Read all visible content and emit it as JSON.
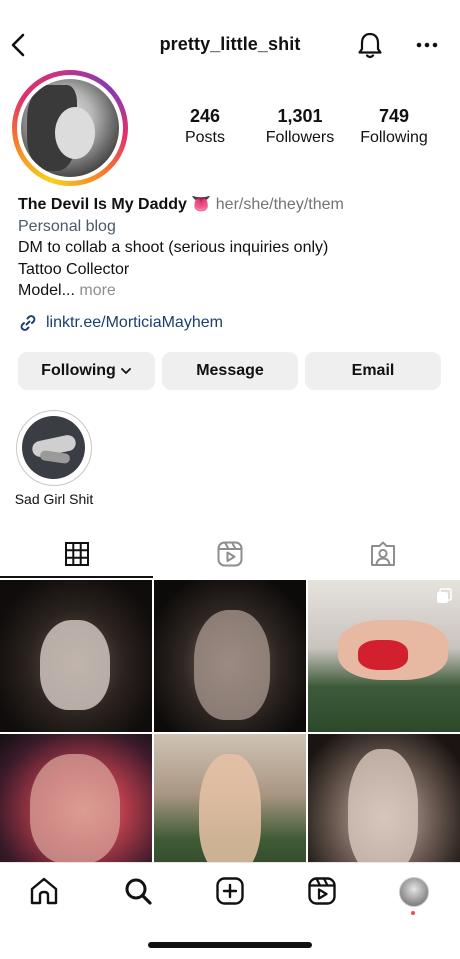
{
  "header": {
    "username": "pretty_little_shit",
    "back_icon": "chevron-left-icon",
    "notifications_icon": "bell-icon",
    "options_icon": "more-horizontal-icon"
  },
  "profile": {
    "stats": [
      {
        "value": "246",
        "label": "Posts"
      },
      {
        "value": "1,301",
        "label": "Followers"
      },
      {
        "value": "749",
        "label": "Following"
      }
    ],
    "display_name": "The Devil Is My Daddy",
    "name_emoji": "👅",
    "pronouns": "her/she/they/them",
    "category": "Personal blog",
    "bio_lines": [
      "DM to collab a shoot (serious inquiries only)",
      "Tattoo Collector",
      "Model..."
    ],
    "more_label": "more",
    "link": "linktr.ee/MorticiaMayhem"
  },
  "actions": {
    "following_label": "Following",
    "message_label": "Message",
    "email_label": "Email"
  },
  "highlights": [
    {
      "label": "Sad Girl Shit"
    }
  ],
  "tabs": [
    {
      "icon": "grid-icon",
      "active": true
    },
    {
      "icon": "reels-icon",
      "active": false
    },
    {
      "icon": "tagged-icon",
      "active": false
    }
  ],
  "bottom_nav": [
    {
      "icon": "home-icon"
    },
    {
      "icon": "search-icon"
    },
    {
      "icon": "create-icon"
    },
    {
      "icon": "reels-icon"
    },
    {
      "icon": "profile-avatar"
    }
  ],
  "colors": {
    "link": "#1c3f6e",
    "button_bg": "#efefef",
    "notification_dot": "#ed4956"
  }
}
